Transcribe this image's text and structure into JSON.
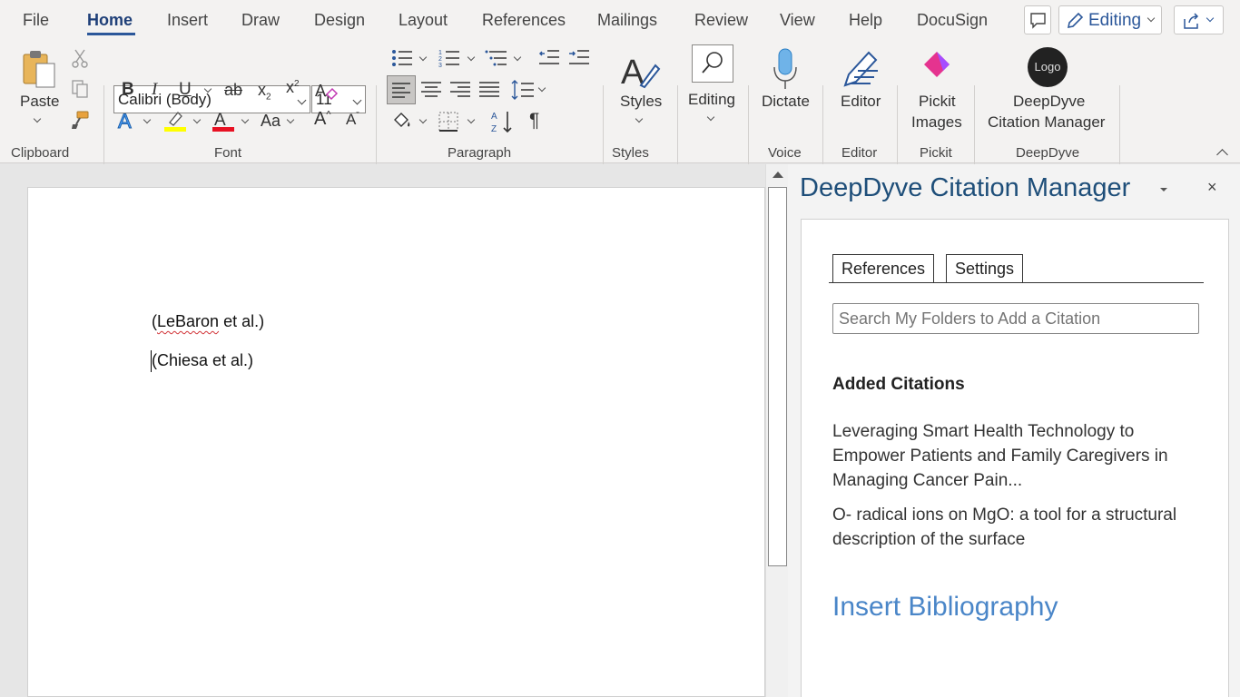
{
  "menu": {
    "tabs": [
      {
        "label": "File"
      },
      {
        "label": "Home"
      },
      {
        "label": "Insert"
      },
      {
        "label": "Draw"
      },
      {
        "label": "Design"
      },
      {
        "label": "Layout"
      },
      {
        "label": "References"
      },
      {
        "label": "Mailings"
      },
      {
        "label": "Review"
      },
      {
        "label": "View"
      },
      {
        "label": "Help"
      },
      {
        "label": "DocuSign"
      }
    ],
    "active_tab": "Home",
    "editing_label": "Editing"
  },
  "ribbon": {
    "clipboard": {
      "paste_label": "Paste",
      "group_label": "Clipboard"
    },
    "font": {
      "family": "Calibri (Body)",
      "size": "11",
      "group_label": "Font",
      "change_case_label": "Aa"
    },
    "paragraph": {
      "group_label": "Paragraph"
    },
    "styles": {
      "label": "Styles",
      "group_label": "Styles"
    },
    "editing": {
      "label": "Editing"
    },
    "voice": {
      "dictate_label": "Dictate",
      "group_label": "Voice"
    },
    "editor": {
      "label": "Editor",
      "group_label": "Editor"
    },
    "pickit": {
      "label_line1": "Pickit",
      "label_line2": "Images",
      "group_label": "Pickit"
    },
    "deepdyve": {
      "logo_text": "Logo",
      "label_line1": "DeepDyve",
      "label_line2": "Citation Manager",
      "group_label": "DeepDyve"
    }
  },
  "document": {
    "lines": [
      {
        "prefix": "(",
        "flagged": "LeBaron",
        "suffix": " et al.)"
      },
      {
        "prefix": "(Chiesa et al.)",
        "flagged": "",
        "suffix": ""
      }
    ]
  },
  "pane": {
    "title": "DeepDyve Citation Manager",
    "close_glyph": "×",
    "tabs": [
      {
        "label": "References"
      },
      {
        "label": "Settings"
      }
    ],
    "search_placeholder": "Search My Folders to Add a Citation",
    "added_heading": "Added Citations",
    "citations": [
      {
        "title": "Leveraging Smart Health Technology to Empower Patients and Family Caregivers in Managing Cancer Pain..."
      },
      {
        "title": "O- radical ions on MgO: a tool for a structural description of the surface"
      }
    ],
    "insert_bibliography": "Insert Bibliography"
  },
  "colors": {
    "accent": "#2b579a",
    "pane_title": "#1e4e79",
    "link": "#4a86c8",
    "highlight": "#ffff00",
    "font_color": "#e81123"
  }
}
